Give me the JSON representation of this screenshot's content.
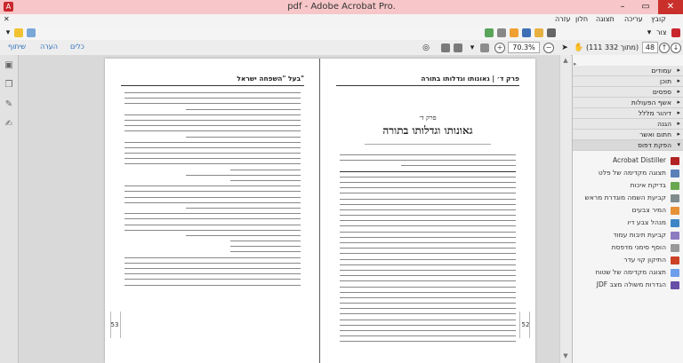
{
  "window": {
    "title": "pdf - Adobe Acrobat Pro."
  },
  "menu": {
    "items": [
      "קובץ",
      "עריכה",
      "תצוגה",
      "חלון",
      "עזרה"
    ]
  },
  "toolbar": {
    "create_label": "צור",
    "page_current": "48",
    "page_of": "(111 מתוך 332)",
    "zoom": "70.3%",
    "right_tools": [
      "כלים",
      "הערה",
      "שיתוף"
    ]
  },
  "left_page": {
    "running_head": "בעל \"השפחה ישראל\"",
    "page_number": "53"
  },
  "right_page": {
    "running_head_left": "פרק ד׳ | גאונותו וגדלותו בתורה",
    "chapter_sub": "פרק ד׳",
    "chapter_title": "גאונותו וגדלותו בתורה",
    "page_number": "52"
  },
  "panel": {
    "sections": [
      "עמודים",
      "תוכן",
      "ספסים",
      "אשף הפעולות",
      "דיהור מללל",
      "הגנה",
      "חתום ואשר",
      "הפקת דפוס"
    ],
    "tools": [
      {
        "label": "Acrobat Distiller",
        "color": "#b22222"
      },
      {
        "label": "תצוגה מקדימה של פלט",
        "color": "#5b7fb8"
      },
      {
        "label": "בדיקת איכות",
        "color": "#6aa84f"
      },
      {
        "label": "קביעת השמה מוגדרת מראש",
        "color": "#7f8c8d"
      },
      {
        "label": "המיר צבעים",
        "color": "#e69138"
      },
      {
        "label": "מנהל צבע דיו",
        "color": "#3d85c6"
      },
      {
        "label": "קביעת תיבות עמוד",
        "color": "#8e7cc3"
      },
      {
        "label": "הוסף סימני מדפסת",
        "color": "#999999"
      },
      {
        "label": "התיקון קוי עדר",
        "color": "#cc4125"
      },
      {
        "label": "תצוגה מקדימה של שטוח",
        "color": "#6d9eeb"
      },
      {
        "label": "הגדרות משולה מצב JDF",
        "color": "#674ea7"
      }
    ]
  }
}
